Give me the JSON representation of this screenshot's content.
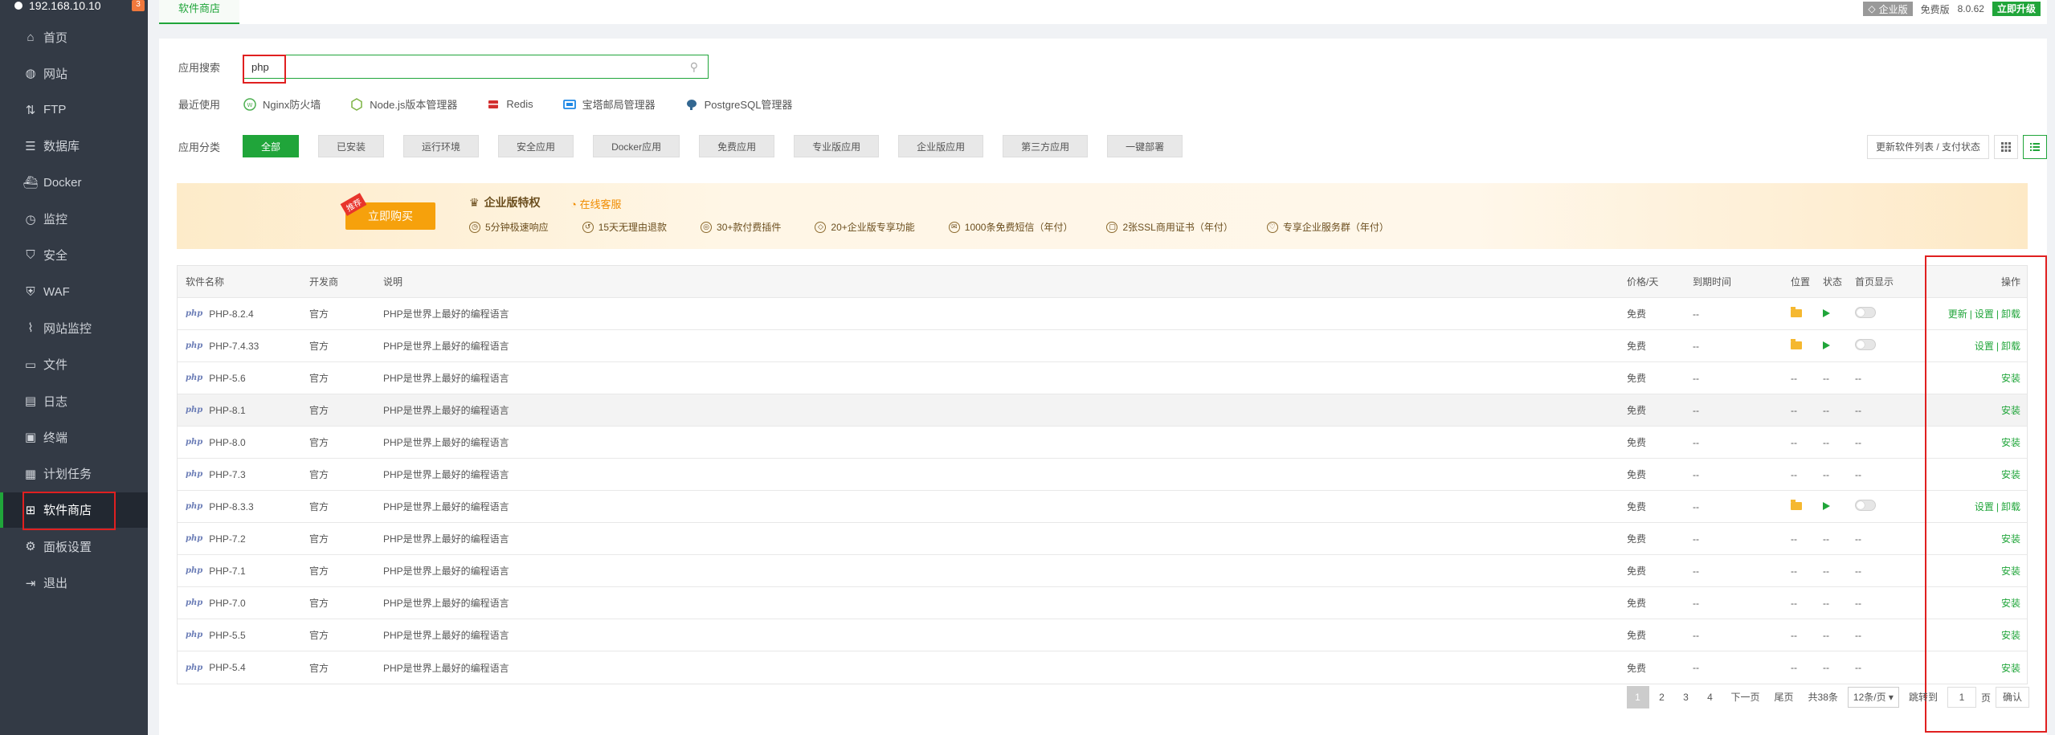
{
  "sidebar": {
    "server_ip": "192.168.10.10",
    "badge": "3",
    "items": [
      {
        "label": "首页",
        "icon": "home-icon"
      },
      {
        "label": "网站",
        "icon": "globe-icon"
      },
      {
        "label": "FTP",
        "icon": "ftp-icon"
      },
      {
        "label": "数据库",
        "icon": "database-icon"
      },
      {
        "label": "Docker",
        "icon": "docker-icon"
      },
      {
        "label": "监控",
        "icon": "monitor-icon"
      },
      {
        "label": "安全",
        "icon": "shield-icon"
      },
      {
        "label": "WAF",
        "icon": "waf-icon"
      },
      {
        "label": "网站监控",
        "icon": "chart-icon"
      },
      {
        "label": "文件",
        "icon": "folder-icon"
      },
      {
        "label": "日志",
        "icon": "log-icon"
      },
      {
        "label": "终端",
        "icon": "terminal-icon"
      },
      {
        "label": "计划任务",
        "icon": "calendar-icon"
      },
      {
        "label": "软件商店",
        "icon": "grid-icon"
      },
      {
        "label": "面板设置",
        "icon": "gear-icon"
      },
      {
        "label": "退出",
        "icon": "logout-icon"
      }
    ],
    "active_index": 13
  },
  "topbar": {
    "tab": "软件商店",
    "edition": "企业版",
    "free_label": "免费版",
    "version": "8.0.62",
    "upgrade": "立即升级"
  },
  "search": {
    "label": "应用搜索",
    "value": "php",
    "placeholder": ""
  },
  "recent": {
    "label": "最近使用",
    "items": [
      "Nginx防火墙",
      "Node.js版本管理器",
      "Redis",
      "宝塔邮局管理器",
      "PostgreSQL管理器"
    ]
  },
  "categories": {
    "label": "应用分类",
    "items": [
      "全部",
      "已安装",
      "运行环境",
      "安全应用",
      "Docker应用",
      "免费应用",
      "专业版应用",
      "企业版应用",
      "第三方应用",
      "一键部署"
    ],
    "active_index": 0,
    "refresh_button": "更新软件列表 / 支付状态"
  },
  "banner": {
    "tag": "推荐",
    "buy": "立即购买",
    "title": "企业版特权",
    "service": "在线客服",
    "features": [
      "5分钟极速响应",
      "15天无理由退款",
      "30+款付费插件",
      "20+企业版专享功能",
      "1000条免费短信（年付）",
      "2张SSL商用证书（年付）",
      "专享企业服务群（年付）"
    ]
  },
  "table": {
    "headers": {
      "name": "软件名称",
      "dev": "开发商",
      "desc": "说明",
      "price": "价格/天",
      "expire": "到期时间",
      "location": "位置",
      "status": "状态",
      "homepage": "首页显示",
      "ops": "操作"
    },
    "rows": [
      {
        "name": "PHP-8.2.4",
        "dev": "官方",
        "desc": "PHP是世界上最好的编程语言",
        "price": "免费",
        "expire": "--",
        "installed": true,
        "ops": [
          "更新",
          "设置",
          "卸载"
        ]
      },
      {
        "name": "PHP-7.4.33",
        "dev": "官方",
        "desc": "PHP是世界上最好的编程语言",
        "price": "免费",
        "expire": "--",
        "installed": true,
        "ops": [
          "设置",
          "卸载"
        ]
      },
      {
        "name": "PHP-5.6",
        "dev": "官方",
        "desc": "PHP是世界上最好的编程语言",
        "price": "免费",
        "expire": "--",
        "installed": false,
        "ops": [
          "安装"
        ]
      },
      {
        "name": "PHP-8.1",
        "dev": "官方",
        "desc": "PHP是世界上最好的编程语言",
        "price": "免费",
        "expire": "--",
        "installed": false,
        "ops": [
          "安装"
        ],
        "hover": true
      },
      {
        "name": "PHP-8.0",
        "dev": "官方",
        "desc": "PHP是世界上最好的编程语言",
        "price": "免费",
        "expire": "--",
        "installed": false,
        "ops": [
          "安装"
        ]
      },
      {
        "name": "PHP-7.3",
        "dev": "官方",
        "desc": "PHP是世界上最好的编程语言",
        "price": "免费",
        "expire": "--",
        "installed": false,
        "ops": [
          "安装"
        ]
      },
      {
        "name": "PHP-8.3.3",
        "dev": "官方",
        "desc": "PHP是世界上最好的编程语言",
        "price": "免费",
        "expire": "--",
        "installed": true,
        "ops": [
          "设置",
          "卸载"
        ]
      },
      {
        "name": "PHP-7.2",
        "dev": "官方",
        "desc": "PHP是世界上最好的编程语言",
        "price": "免费",
        "expire": "--",
        "installed": false,
        "ops": [
          "安装"
        ]
      },
      {
        "name": "PHP-7.1",
        "dev": "官方",
        "desc": "PHP是世界上最好的编程语言",
        "price": "免费",
        "expire": "--",
        "installed": false,
        "ops": [
          "安装"
        ]
      },
      {
        "name": "PHP-7.0",
        "dev": "官方",
        "desc": "PHP是世界上最好的编程语言",
        "price": "免费",
        "expire": "--",
        "installed": false,
        "ops": [
          "安装"
        ]
      },
      {
        "name": "PHP-5.5",
        "dev": "官方",
        "desc": "PHP是世界上最好的编程语言",
        "price": "免费",
        "expire": "--",
        "installed": false,
        "ops": [
          "安装"
        ]
      },
      {
        "name": "PHP-5.4",
        "dev": "官方",
        "desc": "PHP是世界上最好的编程语言",
        "price": "免费",
        "expire": "--",
        "installed": false,
        "ops": [
          "安装"
        ]
      }
    ],
    "placeholder_dash": "--",
    "php_logo": "php"
  },
  "pagination": {
    "pages": [
      "1",
      "2",
      "3",
      "4"
    ],
    "active_page": "1",
    "next": "下一页",
    "last": "尾页",
    "total": "共38条",
    "per_page": "12条/页",
    "jump_label": "跳转到",
    "jump_value": "1",
    "page_unit": "页",
    "confirm": "确认"
  },
  "colors": {
    "accent": "#20a53a",
    "sidebar_bg": "#333a45",
    "highlight": "#e02020"
  }
}
